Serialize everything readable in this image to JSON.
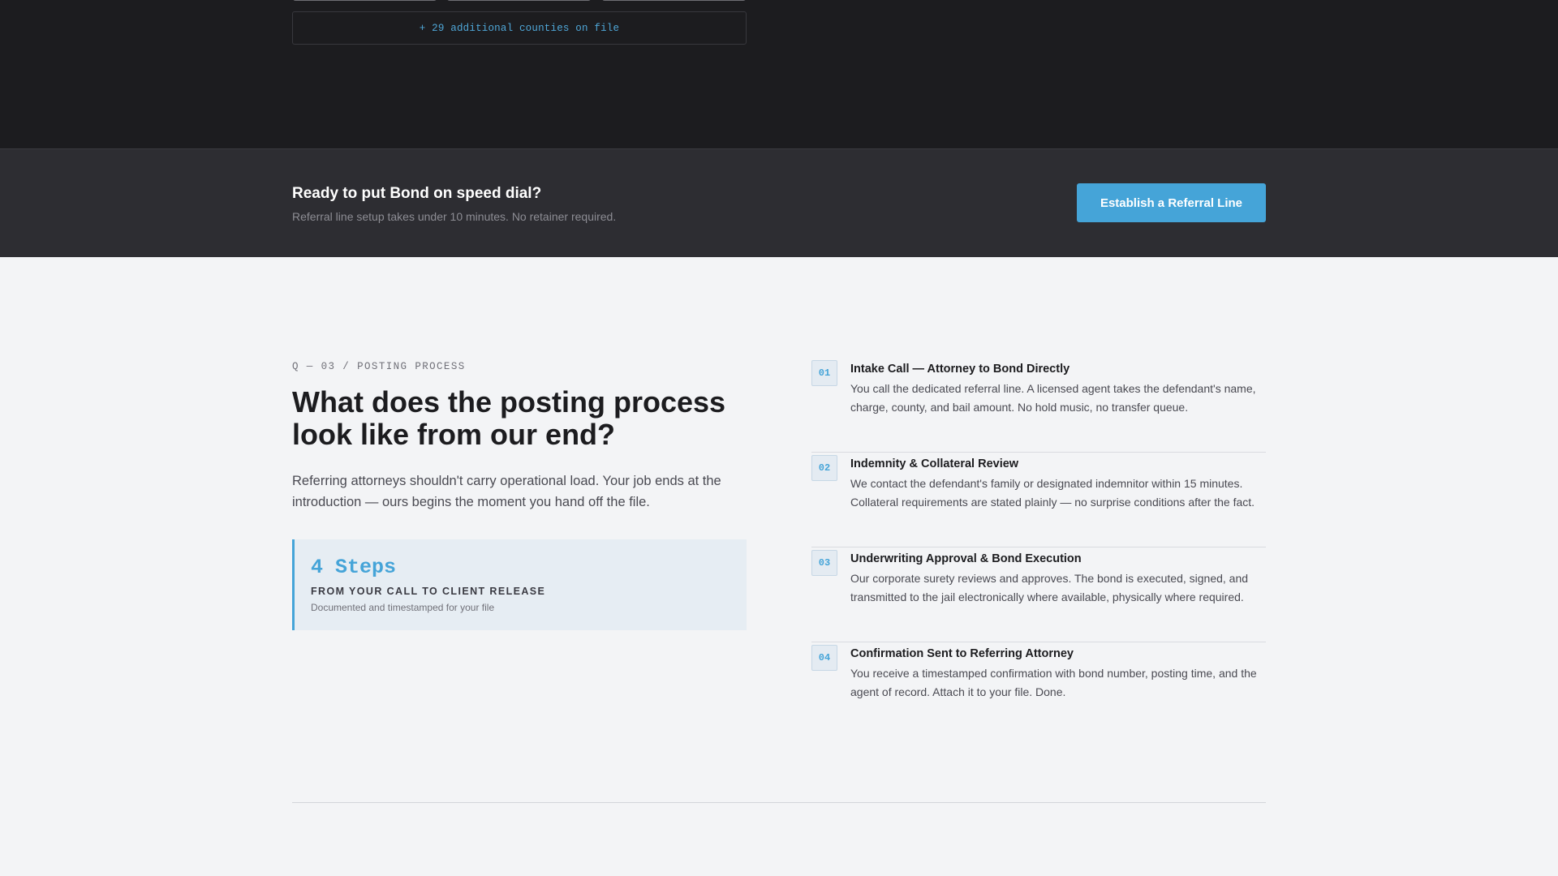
{
  "counties": {
    "more_label": "+ 29 additional counties on file"
  },
  "cta": {
    "title": "Ready to put Bond on speed dial?",
    "subtitle": "Referral line setup takes under 10 minutes. No retainer required.",
    "button_label": "Establish a Referral Line"
  },
  "process": {
    "kicker": "Q — 03 / POSTING PROCESS",
    "heading": "What does the posting process look like from our end?",
    "lead": "Referring attorneys shouldn't carry operational load. Your job ends at the introduction — ours begins the moment you hand off the file.",
    "callout": {
      "count": "4 Steps",
      "caption": "FROM YOUR CALL TO CLIENT RELEASE",
      "note": "Documented and timestamped for your file"
    },
    "steps": [
      {
        "num": "01",
        "title": "Intake Call — Attorney to Bond Directly",
        "desc": "You call the dedicated referral line. A licensed agent takes the defendant's name, charge, county, and bail amount. No hold music, no transfer queue."
      },
      {
        "num": "02",
        "title": "Indemnity & Collateral Review",
        "desc": "We contact the defendant's family or designated indemnitor within 15 minutes. Collateral requirements are stated plainly — no surprise conditions after the fact."
      },
      {
        "num": "03",
        "title": "Underwriting Approval & Bond Execution",
        "desc": "Our corporate surety reviews and approves. The bond is executed, signed, and transmitted to the jail electronically where available, physically where required."
      },
      {
        "num": "04",
        "title": "Confirmation Sent to Referring Attorney",
        "desc": "You receive a timestamped confirmation with bond number, posting time, and the agent of record. Attach it to your file. Done."
      }
    ]
  },
  "colors": {
    "accent": "#45a4d8",
    "dark_bg": "#1c1c1f",
    "band_bg": "#2d2d32",
    "light_bg": "#f3f4f6"
  }
}
